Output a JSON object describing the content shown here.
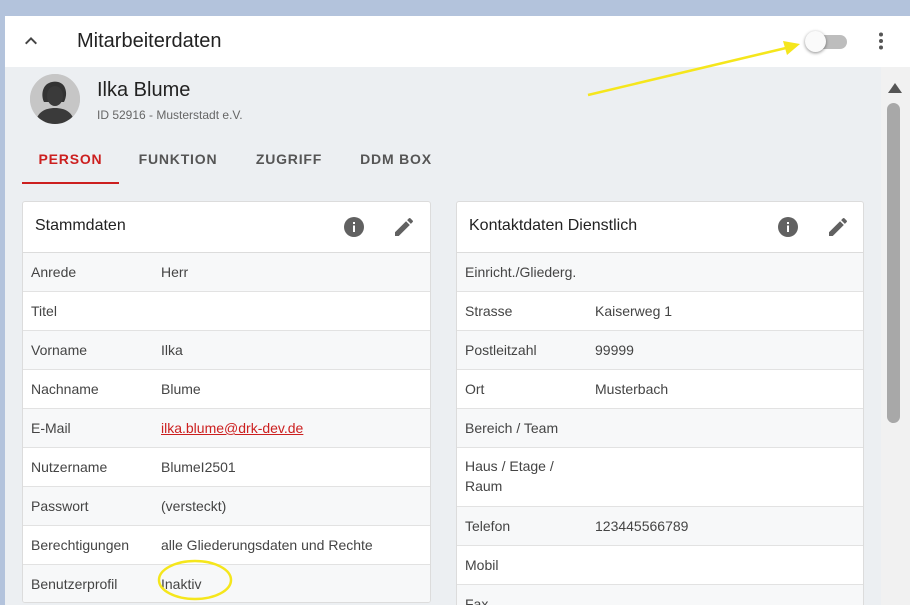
{
  "header": {
    "title": "Mitarbeiterdaten"
  },
  "profile": {
    "name": "Ilka Blume",
    "id_line": "ID 52916 - Musterstadt e.V."
  },
  "tabs": [
    {
      "label": "PERSON"
    },
    {
      "label": "FUNKTION"
    },
    {
      "label": "ZUGRIFF"
    },
    {
      "label": "DDM BOX"
    }
  ],
  "stammdaten": {
    "title": "Stammdaten",
    "rows": [
      {
        "label": "Anrede",
        "value": "Herr"
      },
      {
        "label": "Titel",
        "value": ""
      },
      {
        "label": "Vorname",
        "value": "Ilka"
      },
      {
        "label": "Nachname",
        "value": "Blume"
      },
      {
        "label": "E-Mail",
        "value": "ilka.blume@drk-dev.de"
      },
      {
        "label": "Nutzername",
        "value": "BlumeI2501"
      },
      {
        "label": "Passwort",
        "value": "(versteckt)"
      },
      {
        "label": "Berechtigungen",
        "value": "alle Gliederungsdaten und Rechte"
      },
      {
        "label": "Benutzerprofil",
        "value": "Inaktiv"
      }
    ]
  },
  "kontakt": {
    "title": "Kontaktdaten Dienstlich",
    "rows": [
      {
        "label": "Einricht./Gliederg.",
        "value": ""
      },
      {
        "label": "Strasse",
        "value": "Kaiserweg 1"
      },
      {
        "label": "Postleitzahl",
        "value": "99999"
      },
      {
        "label": "Ort",
        "value": "Musterbach"
      },
      {
        "label": "Bereich / Team",
        "value": ""
      },
      {
        "label": "Haus / Etage /",
        "label2": "Raum",
        "value": ""
      },
      {
        "label": "Telefon",
        "value": "123445566789"
      },
      {
        "label": "Mobil",
        "value": ""
      },
      {
        "label": "Fax",
        "value": ""
      }
    ]
  },
  "colors": {
    "accent": "#cc1f1f",
    "annotation": "#f5e61c"
  },
  "icons": {
    "collapse": "chevron-up-icon",
    "more": "more-vert-icon",
    "info": "info-icon",
    "edit": "edit-icon",
    "avatar": "user-avatar-icon"
  }
}
